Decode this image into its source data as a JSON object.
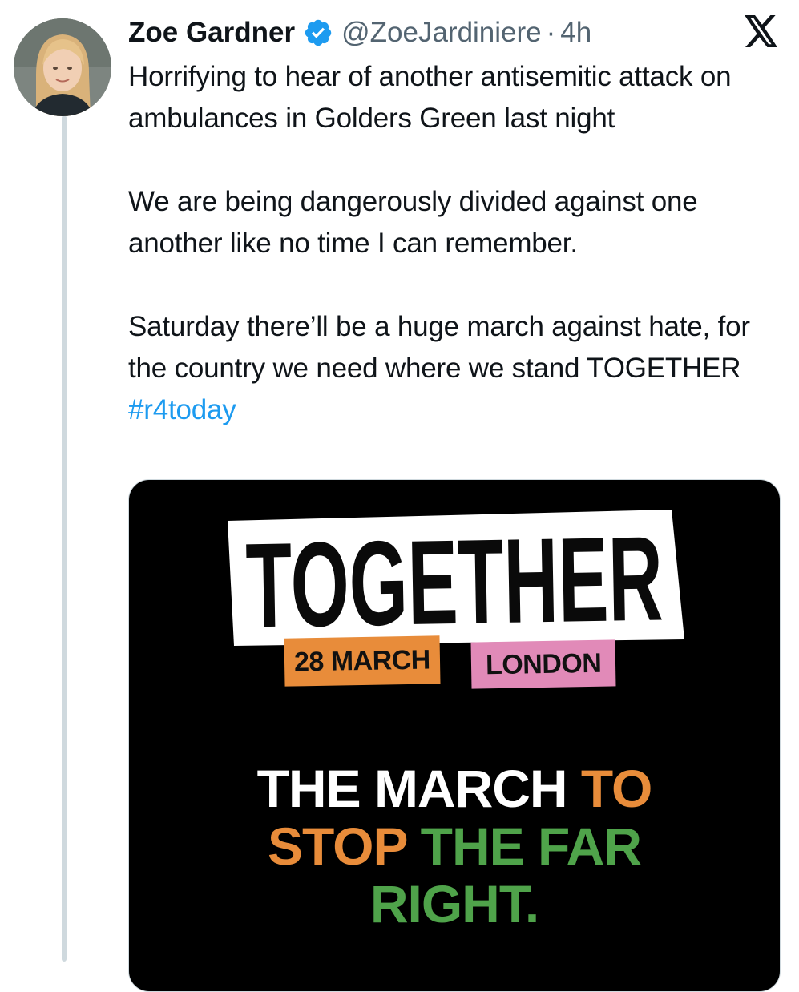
{
  "post": {
    "author": {
      "display_name": "Zoe Gardner",
      "handle": "@ZoeJardiniere",
      "separator": "·",
      "time_ago": "4h",
      "verified": true,
      "avatar_icon": "user-avatar"
    },
    "platform_icon": "x-logo-icon",
    "paragraphs": [
      "Horrifying to hear of another antisemitic attack on ambulances in Golders Green last night",
      "We are being dangerously divided against one another like no time I can remember."
    ],
    "last_paragraph_text": "Saturday there’ll be a huge march against hate, for the country we need where we stand TOGETHER ",
    "hashtag": "#r4today",
    "colors": {
      "text": "#0f1419",
      "secondary": "#536471",
      "link": "#1d9bf0",
      "verified": "#1d9bf0",
      "thread_line": "#cfd9de"
    }
  },
  "media": {
    "banner_title": "TOGETHER",
    "date_label": "28 MARCH",
    "city_label": "LONDON",
    "slogan": {
      "word1": "THE MARCH",
      "word2": "TO",
      "word3": "STOP",
      "word4": "THE FAR",
      "word5": "RIGHT."
    },
    "colors": {
      "background": "#000000",
      "orange": "#e88c3a",
      "pink": "#e18ab8",
      "green": "#4fa34a",
      "white": "#ffffff"
    }
  }
}
